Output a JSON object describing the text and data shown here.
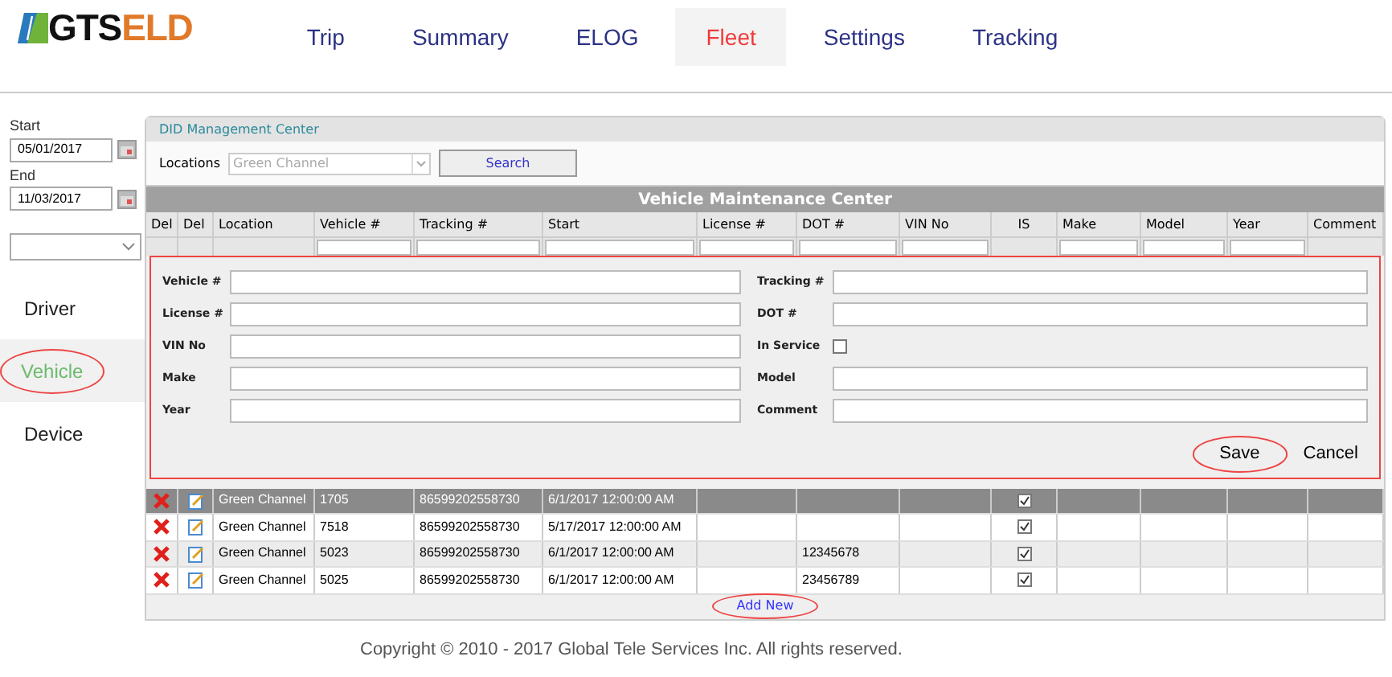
{
  "logo": {
    "part1": "GTS",
    "part2": "ELD"
  },
  "nav": [
    {
      "label": "Trip",
      "selected": false
    },
    {
      "label": "Summary",
      "selected": false
    },
    {
      "label": "ELOG",
      "selected": false
    },
    {
      "label": "Fleet",
      "selected": true
    },
    {
      "label": "Settings",
      "selected": false
    },
    {
      "label": "Tracking",
      "selected": false
    }
  ],
  "sidebar": {
    "start_label": "Start",
    "start_value": "05/01/2017",
    "end_label": "End",
    "end_value": "11/03/2017",
    "items": [
      {
        "label": "Driver",
        "selected": false
      },
      {
        "label": "Vehicle",
        "selected": true
      },
      {
        "label": "Device",
        "selected": false
      }
    ]
  },
  "panel": {
    "title": "DID Management Center",
    "locations_label": "Locations",
    "location_value": "Green Channel",
    "search_button": "Search"
  },
  "table": {
    "title": "Vehicle Maintenance Center",
    "columns": [
      {
        "label": "Del",
        "filter": false
      },
      {
        "label": "Del",
        "filter": false
      },
      {
        "label": "Location",
        "filter": false
      },
      {
        "label": "Vehicle #",
        "filter": true
      },
      {
        "label": "Tracking #",
        "filter": true
      },
      {
        "label": "Start",
        "filter": true
      },
      {
        "label": "License #",
        "filter": true
      },
      {
        "label": "DOT #",
        "filter": true
      },
      {
        "label": "VIN No",
        "filter": true
      },
      {
        "label": "IS",
        "filter": false
      },
      {
        "label": "Make",
        "filter": true
      },
      {
        "label": "Model",
        "filter": true
      },
      {
        "label": "Year",
        "filter": true
      },
      {
        "label": "Comment",
        "filter": false
      }
    ],
    "rows": [
      {
        "selected": true,
        "location": "Green Channel",
        "vehicle": "1705",
        "tracking": "86599202558730",
        "start": "6/1/2017 12:00:00 AM",
        "in_service": true
      },
      {
        "selected": false,
        "location": "Green Channel",
        "vehicle": "7518",
        "tracking": "86599202558730",
        "start": "5/17/2017 12:00:00 AM",
        "in_service": true
      },
      {
        "selected": false,
        "location": "Green Channel",
        "vehicle": "5023",
        "tracking": "86599202558730",
        "start": "6/1/2017 12:00:00 AM",
        "dot": "12345678",
        "in_service": true
      },
      {
        "selected": false,
        "location": "Green Channel",
        "vehicle": "5025",
        "tracking": "86599202558730",
        "start": "6/1/2017 12:00:00 AM",
        "dot": "23456789",
        "in_service": true
      }
    ],
    "add_new": "Add New"
  },
  "form": {
    "left": [
      {
        "label": "Vehicle #",
        "kind": "text"
      },
      {
        "label": "License #",
        "kind": "text"
      },
      {
        "label": "VIN No",
        "kind": "text"
      },
      {
        "label": "Make",
        "kind": "text"
      },
      {
        "label": "Year",
        "kind": "text"
      }
    ],
    "right": [
      {
        "label": "Tracking #",
        "kind": "text"
      },
      {
        "label": "DOT #",
        "kind": "text"
      },
      {
        "label": "In Service",
        "kind": "checkbox",
        "checked": false
      },
      {
        "label": "Model",
        "kind": "text"
      },
      {
        "label": "Comment",
        "kind": "text"
      }
    ],
    "save": "Save",
    "cancel": "Cancel"
  },
  "footer": "Copyright © 2010 - 2017 Global Tele Services Inc. All rights reserved."
}
